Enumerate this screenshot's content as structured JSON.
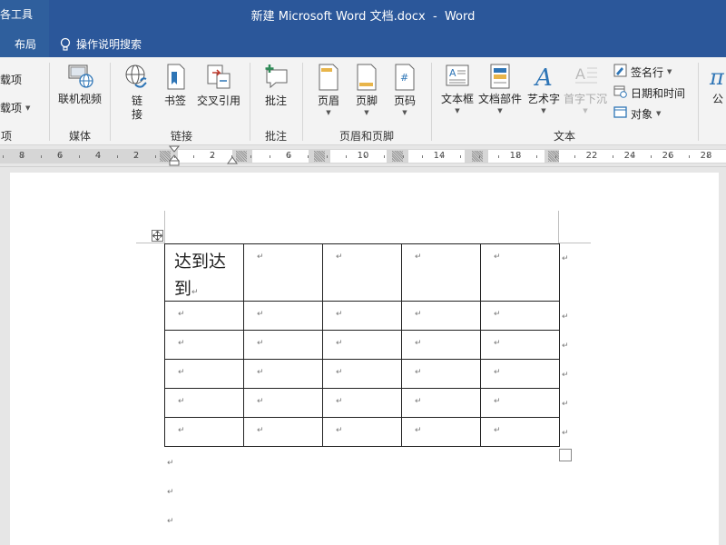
{
  "titlebar": {
    "context_label": "各工具",
    "doc_title": "新建 Microsoft Word 文档.docx  -  Word"
  },
  "tabs": {
    "layout": "布局",
    "tell_me": "操作说明搜索"
  },
  "ribbon": {
    "partial": {
      "addin1": "载项",
      "addin2": "载项",
      "group": "项"
    },
    "media": {
      "online_video": "联机视频",
      "group": "媒体"
    },
    "links": {
      "link_line1": "链",
      "link_line2": "接",
      "bookmark": "书签",
      "cross_ref": "交叉引用",
      "group": "链接"
    },
    "comments": {
      "comment": "批注",
      "group": "批注"
    },
    "header_footer": {
      "header": "页眉",
      "footer": "页脚",
      "page_number": "页码",
      "group": "页眉和页脚"
    },
    "text": {
      "textbox": "文本框",
      "quick_parts": "文档部件",
      "wordart": "艺术字",
      "dropcap": "首字下沉",
      "signature": "签名行",
      "datetime": "日期和时间",
      "object": "对象",
      "group": "文本"
    },
    "partial_right": "公"
  },
  "ruler": {
    "labels": [
      "8",
      "6",
      "4",
      "2",
      "2",
      "6",
      "10",
      "14",
      "18",
      "22",
      "24",
      "26",
      "28"
    ]
  },
  "document": {
    "first_cell": "达到达到",
    "first_cell_line1": "达到达",
    "first_cell_line2": "到",
    "para_mark": "↵",
    "rows": 6,
    "cols": 5
  },
  "colors": {
    "title_bar": "#2b579a",
    "ribbon_bg": "#f3f3f3",
    "page_bg": "#ffffff",
    "canvas_bg": "#e6e6e6"
  }
}
